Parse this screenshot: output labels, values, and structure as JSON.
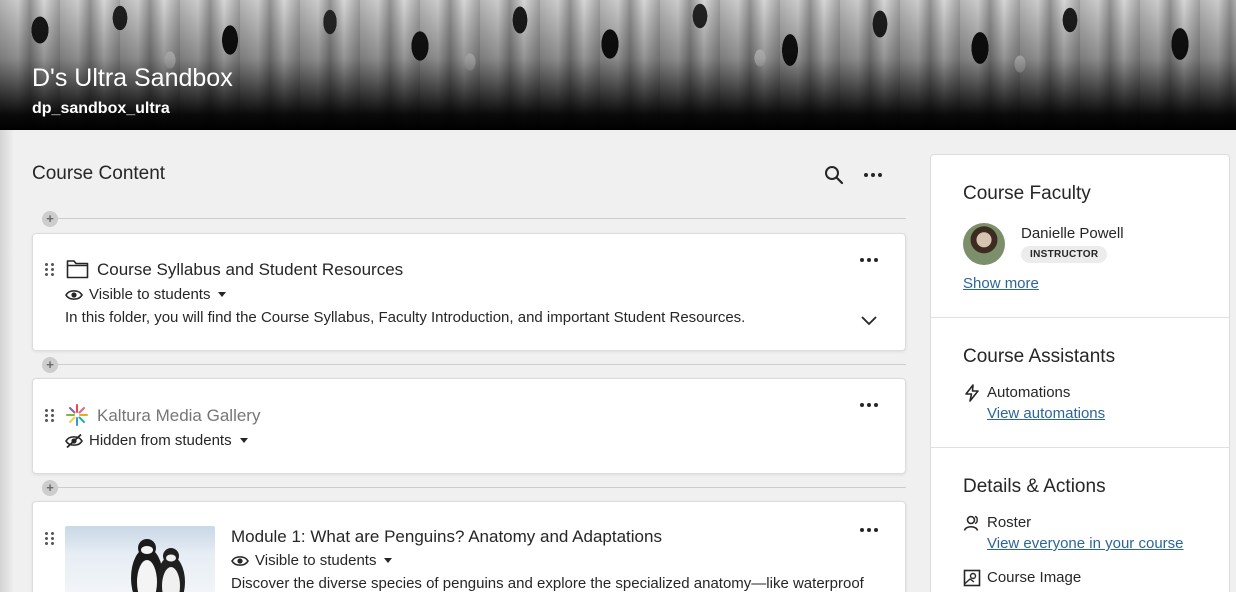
{
  "header": {
    "course_title": "D's Ultra Sandbox",
    "course_id": "dp_sandbox_ultra"
  },
  "content": {
    "section_title": "Course Content",
    "items": [
      {
        "title": "Course Syllabus and Student Resources",
        "icon": "folder-icon",
        "visibility": "Visible to students",
        "description": "In this folder, you will find the Course Syllabus, Faculty Introduction, and important Student Resources."
      },
      {
        "title": "Kaltura Media Gallery",
        "icon": "kaltura-icon",
        "visibility": "Hidden from students"
      },
      {
        "title": "Module 1: What are Penguins? Anatomy and Adaptations",
        "icon": "module-thumbnail",
        "visibility": "Visible to students",
        "description": "Discover the diverse species of penguins and explore the specialized anatomy—like waterproof"
      }
    ]
  },
  "panel": {
    "faculty": {
      "heading": "Course Faculty",
      "name": "Danielle Powell",
      "role": "INSTRUCTOR",
      "show_more": "Show more"
    },
    "assistants": {
      "heading": "Course Assistants",
      "automations_label": "Automations",
      "automations_link": "View automations"
    },
    "details": {
      "heading": "Details & Actions",
      "roster_label": "Roster",
      "roster_link": "View everyone in your course",
      "image_label": "Course Image"
    }
  },
  "colors": {
    "link": "#2b6699",
    "background": "#f0f0f0",
    "hidden_text": "#767676"
  }
}
